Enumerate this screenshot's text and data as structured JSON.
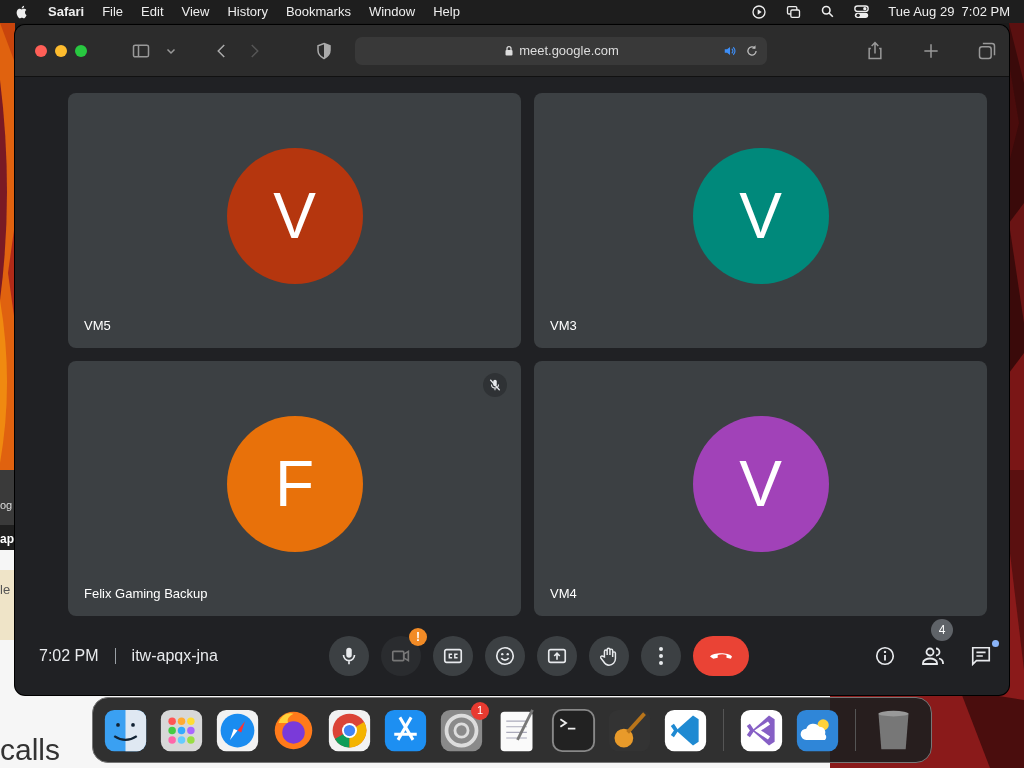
{
  "menu_bar": {
    "app_name": "Safari",
    "menus": [
      "File",
      "Edit",
      "View",
      "History",
      "Bookmarks",
      "Window",
      "Help"
    ],
    "date": "Tue Aug 29",
    "time": "7:02 PM"
  },
  "background_page": {
    "fragments": [
      "og",
      "ap",
      "le"
    ],
    "heading": "calls"
  },
  "browser": {
    "url": "meet.google.com",
    "audio_playing": true
  },
  "tiles": [
    {
      "name": "VM5",
      "initial": "V",
      "color": "#b5360e",
      "muted": false
    },
    {
      "name": "VM3",
      "initial": "V",
      "color": "#00897b",
      "muted": false
    },
    {
      "name": "Felix Gaming Backup",
      "initial": "F",
      "color": "#e8710a",
      "muted": true
    },
    {
      "name": "VM4",
      "initial": "V",
      "color": "#a142b8",
      "muted": false
    }
  ],
  "controls": {
    "time": "7:02 PM",
    "meeting_code": "itw-apqx-jna",
    "buttons": [
      {
        "kind": "mic"
      },
      {
        "kind": "camera",
        "alert": "!"
      },
      {
        "kind": "captions"
      },
      {
        "kind": "emoji"
      },
      {
        "kind": "present"
      },
      {
        "kind": "hand"
      },
      {
        "kind": "more"
      },
      {
        "kind": "hangup"
      }
    ],
    "people_count": "4",
    "chat_unread": true
  },
  "dock": [
    {
      "kind": "finder"
    },
    {
      "kind": "launchpad"
    },
    {
      "kind": "safari"
    },
    {
      "kind": "firefox"
    },
    {
      "kind": "chrome"
    },
    {
      "kind": "appstore"
    },
    {
      "kind": "settings",
      "badge": "1"
    },
    {
      "kind": "textedit"
    },
    {
      "kind": "terminal"
    },
    {
      "kind": "garageband"
    },
    {
      "kind": "vscode"
    },
    {
      "kind": "sep"
    },
    {
      "kind": "vstudio"
    },
    {
      "kind": "weather"
    },
    {
      "kind": "sep"
    },
    {
      "kind": "trash"
    }
  ]
}
